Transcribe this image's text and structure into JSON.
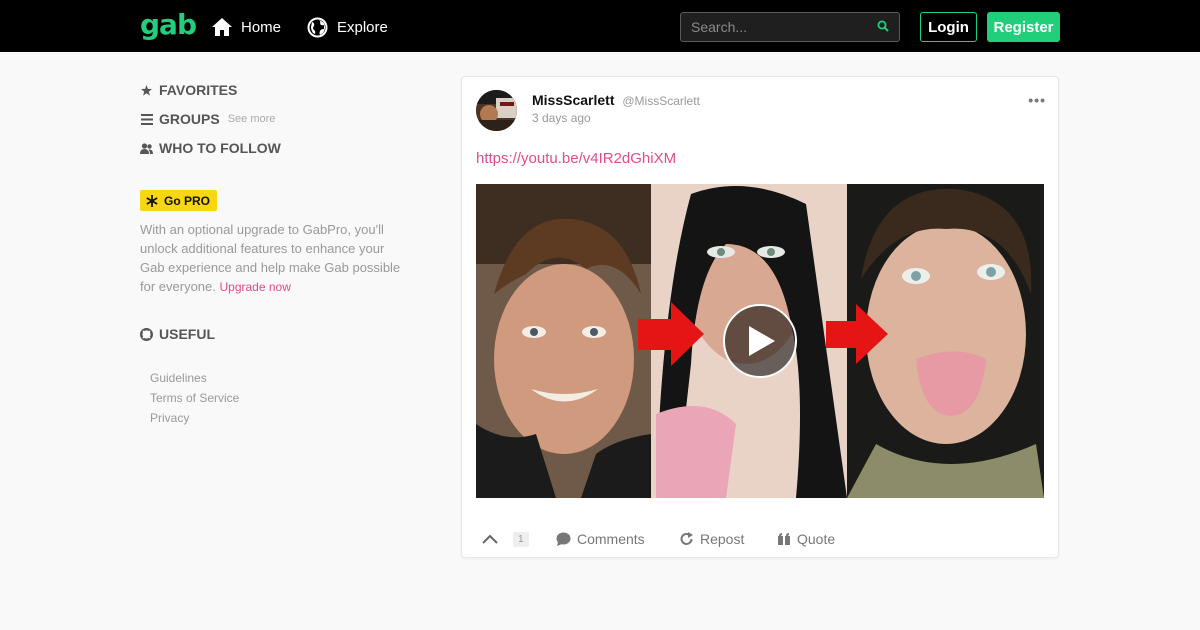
{
  "nav": {
    "logo": "gab",
    "home_label": "Home",
    "explore_label": "Explore",
    "search_placeholder": "Search...",
    "login_label": "Login",
    "register_label": "Register"
  },
  "sidebar": {
    "favorites": "FAVORITES",
    "groups": "GROUPS",
    "see_more": "See more",
    "who_to_follow": "WHO TO FOLLOW",
    "gopro_label": "Go PRO",
    "pro_text": "With an optional upgrade to GabPro, you'll unlock additional features to enhance your Gab experience and help make Gab possible for everyone.",
    "upgrade_link": "Upgrade now",
    "useful": "USEFUL",
    "links": [
      "Guidelines",
      "Terms of Service",
      "Privacy"
    ]
  },
  "post": {
    "author_name": "MissScarlett",
    "author_handle": "@MissScarlett",
    "timestamp": "3 days ago",
    "link": "https://youtu.be/v4IR2dGhiXM",
    "like_count": "1",
    "comments_label": "Comments",
    "repost_label": "Repost",
    "quote_label": "Quote"
  },
  "colors": {
    "brand": "#21cf7a",
    "link": "#e04d8a",
    "pro": "#f8d711"
  }
}
